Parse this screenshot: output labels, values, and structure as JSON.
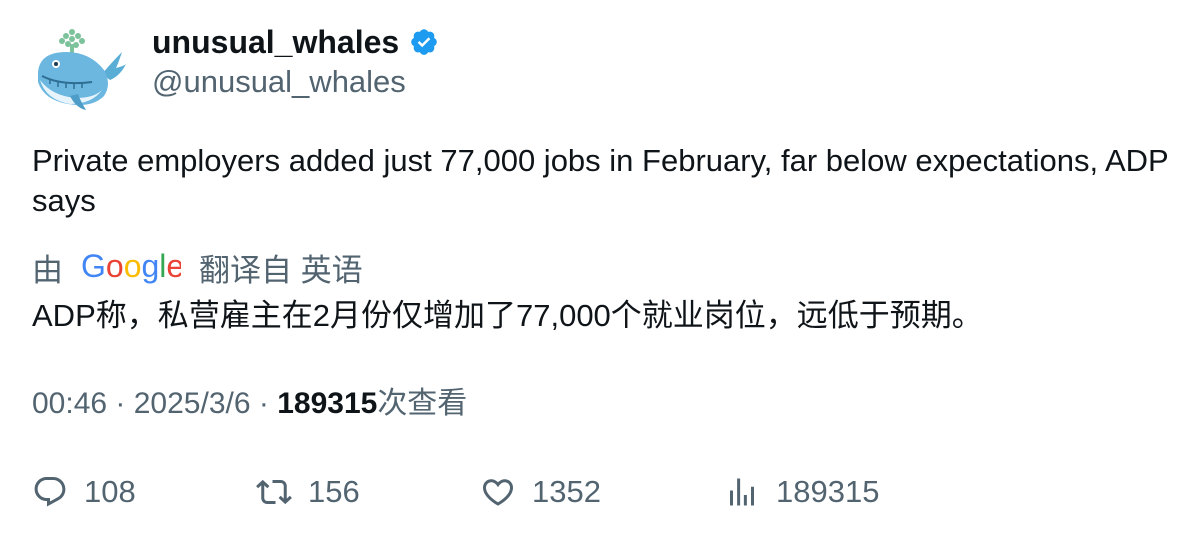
{
  "author": {
    "display_name": "unusual_whales",
    "handle": "@unusual_whales",
    "verified": true,
    "avatar_icon": "whale-icon"
  },
  "tweet": {
    "text": "Private employers added just 77,000 jobs in February, far below expectations, ADP says"
  },
  "translation": {
    "by_label": "由",
    "provider": "Google",
    "translated_from_label": "翻译自 英语",
    "translated_text": "ADP称，私营雇主在2月份仅增加了77,000个就业岗位，远低于预期。"
  },
  "meta": {
    "time": "00:46",
    "separator": "·",
    "date": "2025/3/6",
    "views_count": "189315",
    "views_suffix": "次查看"
  },
  "actions": {
    "replies": "108",
    "retweets": "156",
    "likes": "1352",
    "views": "189315"
  },
  "colors": {
    "text_primary": "#0f1419",
    "text_secondary": "#536471",
    "verified_blue": "#1d9bf0"
  }
}
